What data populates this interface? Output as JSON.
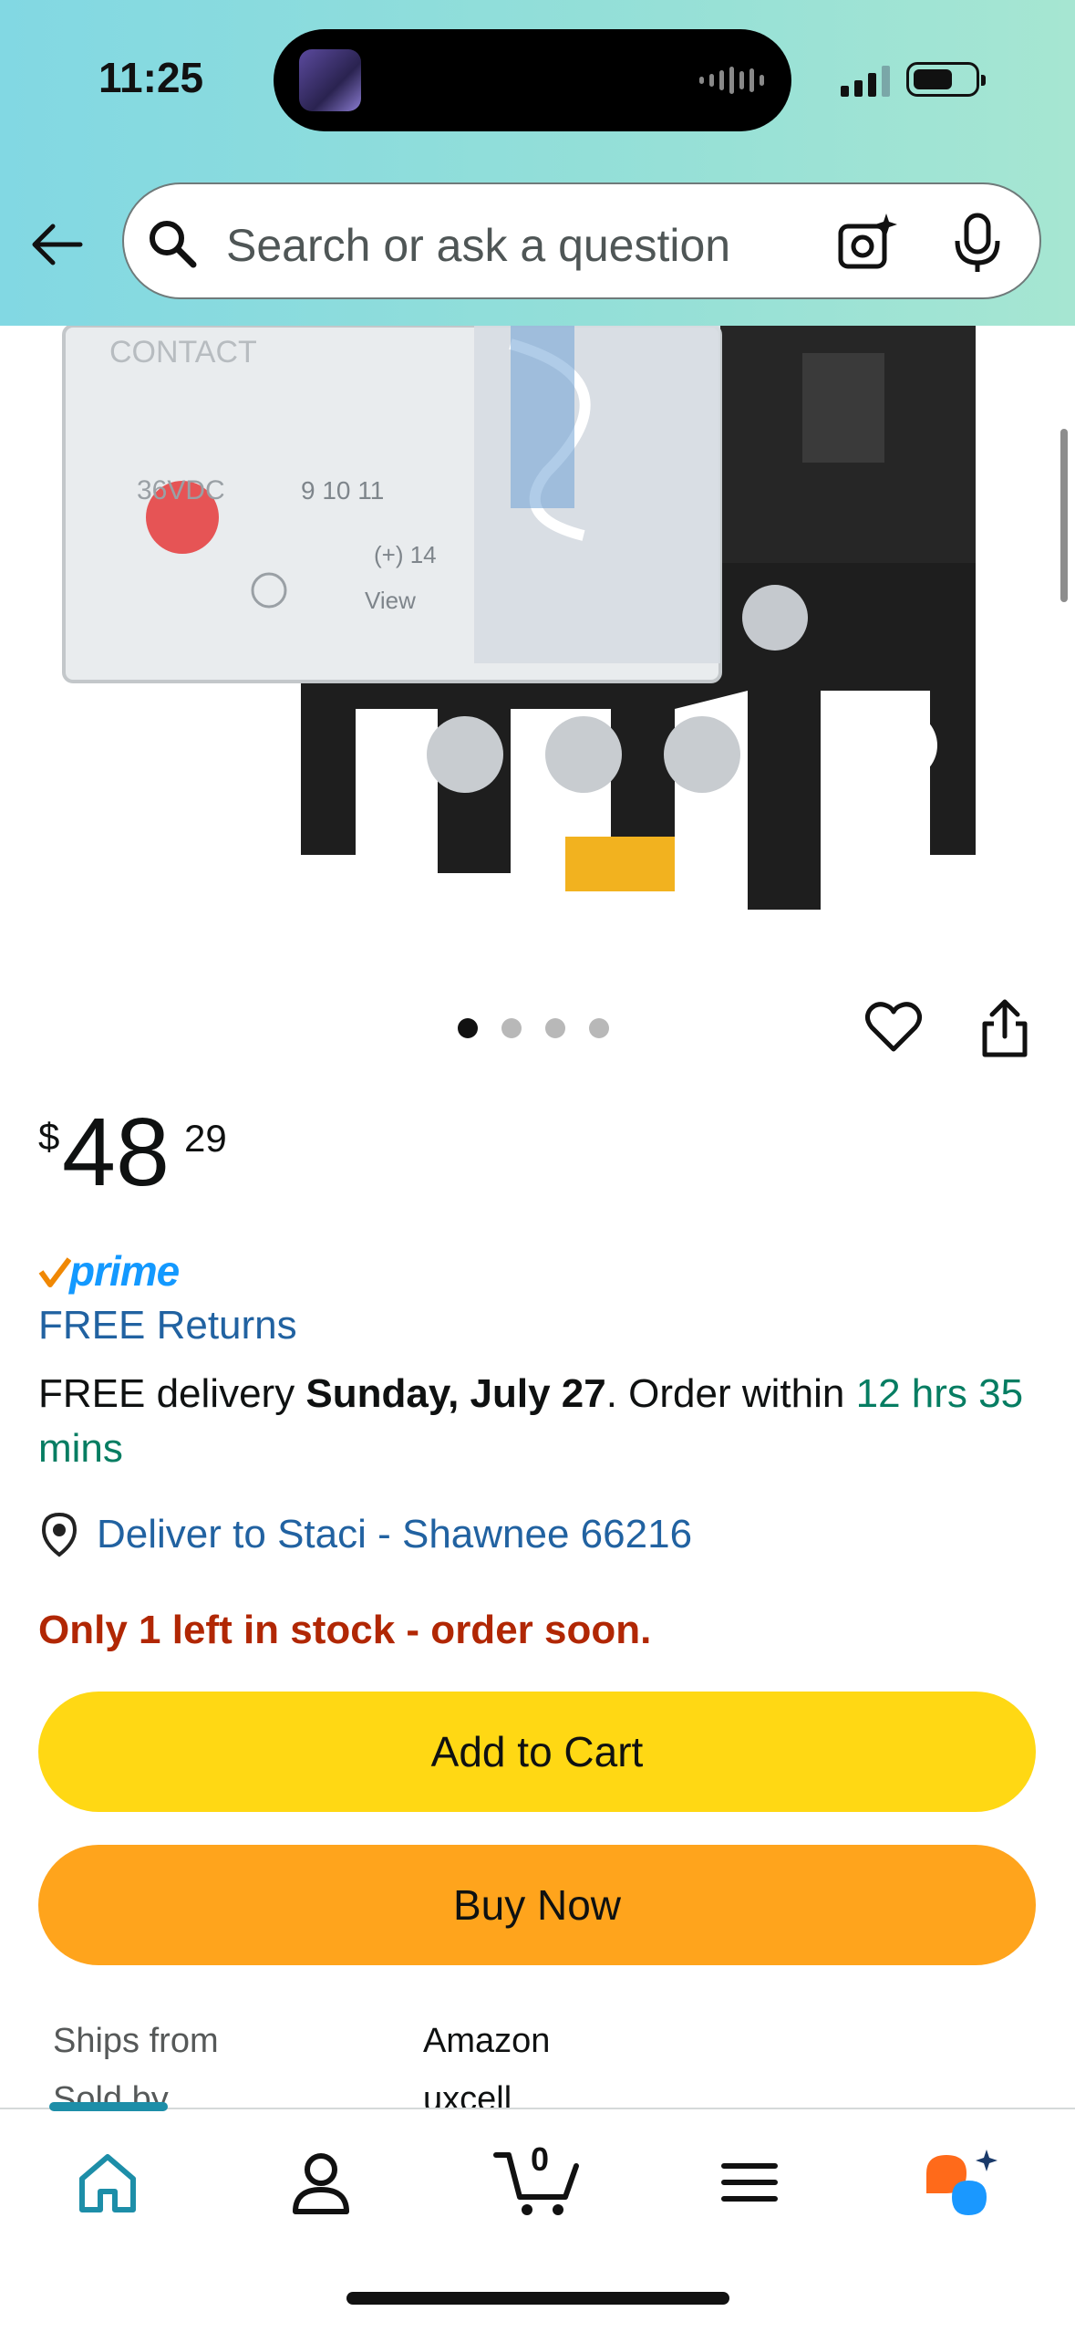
{
  "status_bar": {
    "time": "11:25"
  },
  "search": {
    "placeholder": "Search or ask a question"
  },
  "gallery": {
    "image_count": 4,
    "active_index": 0
  },
  "product": {
    "price_symbol": "$",
    "price_whole": "48",
    "price_fraction": "29",
    "prime_label": "prime",
    "free_returns": "FREE Returns",
    "delivery_prefix": "FREE delivery ",
    "delivery_date": "Sunday, July 27",
    "delivery_mid": ". Order within ",
    "delivery_countdown": "12 hrs 35 mins",
    "deliver_to": "Deliver to Staci - Shawnee 66216",
    "stock_message": "Only 1 left in stock - order soon."
  },
  "buttons": {
    "add_to_cart": "Add to Cart",
    "buy_now": "Buy Now"
  },
  "details": [
    {
      "label": "Ships from",
      "value": "Amazon"
    },
    {
      "label": "Sold by",
      "value": "uxcell"
    }
  ],
  "bottom_nav": {
    "items": [
      "home",
      "account",
      "cart",
      "menu",
      "rufus"
    ],
    "cart_count": "0"
  },
  "colors": {
    "accent_teal": "#1d8ea8",
    "link_blue": "#2162a1",
    "countdown_green": "#067d62",
    "stock_red": "#b12704",
    "add_to_cart_yellow": "#ffd814",
    "buy_now_orange": "#ffa41c",
    "prime_blue": "#1399ff"
  }
}
